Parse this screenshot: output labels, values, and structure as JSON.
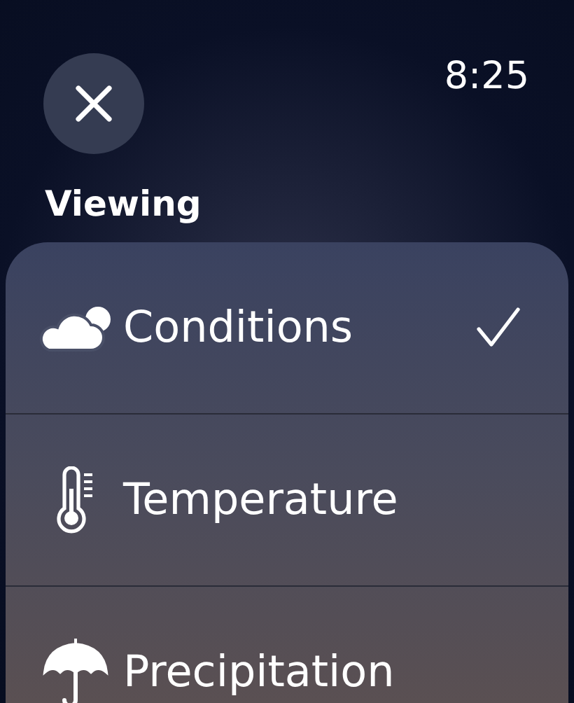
{
  "status_bar": {
    "time": "8:25"
  },
  "title": "Viewing",
  "options": [
    {
      "kind": "conditions",
      "label": "Conditions",
      "selected": true
    },
    {
      "kind": "temperature",
      "label": "Temperature",
      "selected": false
    },
    {
      "kind": "precipitation",
      "label": "Precipitation",
      "selected": false
    }
  ]
}
